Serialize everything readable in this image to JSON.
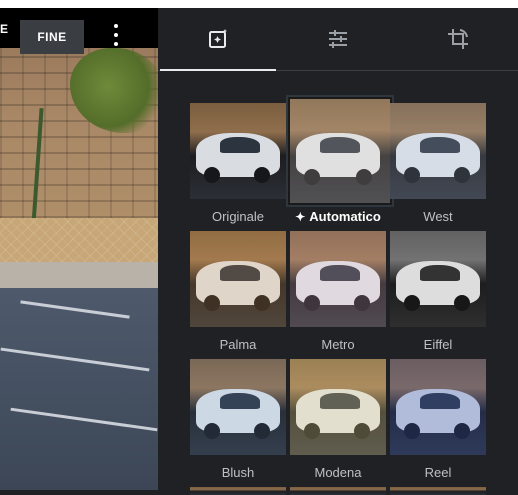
{
  "toolbar": {
    "prev_label": "E",
    "done_label": "FINE",
    "more_icon": "more-vert-icon"
  },
  "tabs": [
    {
      "name": "filters",
      "icon": "auto-filter-icon",
      "active": true
    },
    {
      "name": "adjust",
      "icon": "sliders-icon",
      "active": false
    },
    {
      "name": "crop",
      "icon": "crop-rotate-icon",
      "active": false
    }
  ],
  "filters": [
    {
      "label": "Originale",
      "tint": "rgba(0,0,0,0)"
    },
    {
      "label": "Automatico",
      "tint": "rgba(255,240,220,0.18)",
      "selected": true,
      "icon": "sparkle-icon"
    },
    {
      "label": "West",
      "tint": "rgba(200,220,255,0.15)"
    },
    {
      "label": "Palma",
      "tint": "rgba(255,180,90,0.18)"
    },
    {
      "label": "Metro",
      "tint": "rgba(255,200,210,0.18)"
    },
    {
      "label": "Eiffel",
      "tint": "grayscale"
    },
    {
      "label": "Blush",
      "tint": "rgba(120,180,255,0.12)"
    },
    {
      "label": "Modena",
      "tint": "rgba(255,230,150,0.25)"
    },
    {
      "label": "Reel",
      "tint": "rgba(60,90,200,0.25)"
    }
  ],
  "colors": {
    "panel_bg": "#202124",
    "text": "#bdc1c6",
    "accent": "#e8eaed"
  }
}
